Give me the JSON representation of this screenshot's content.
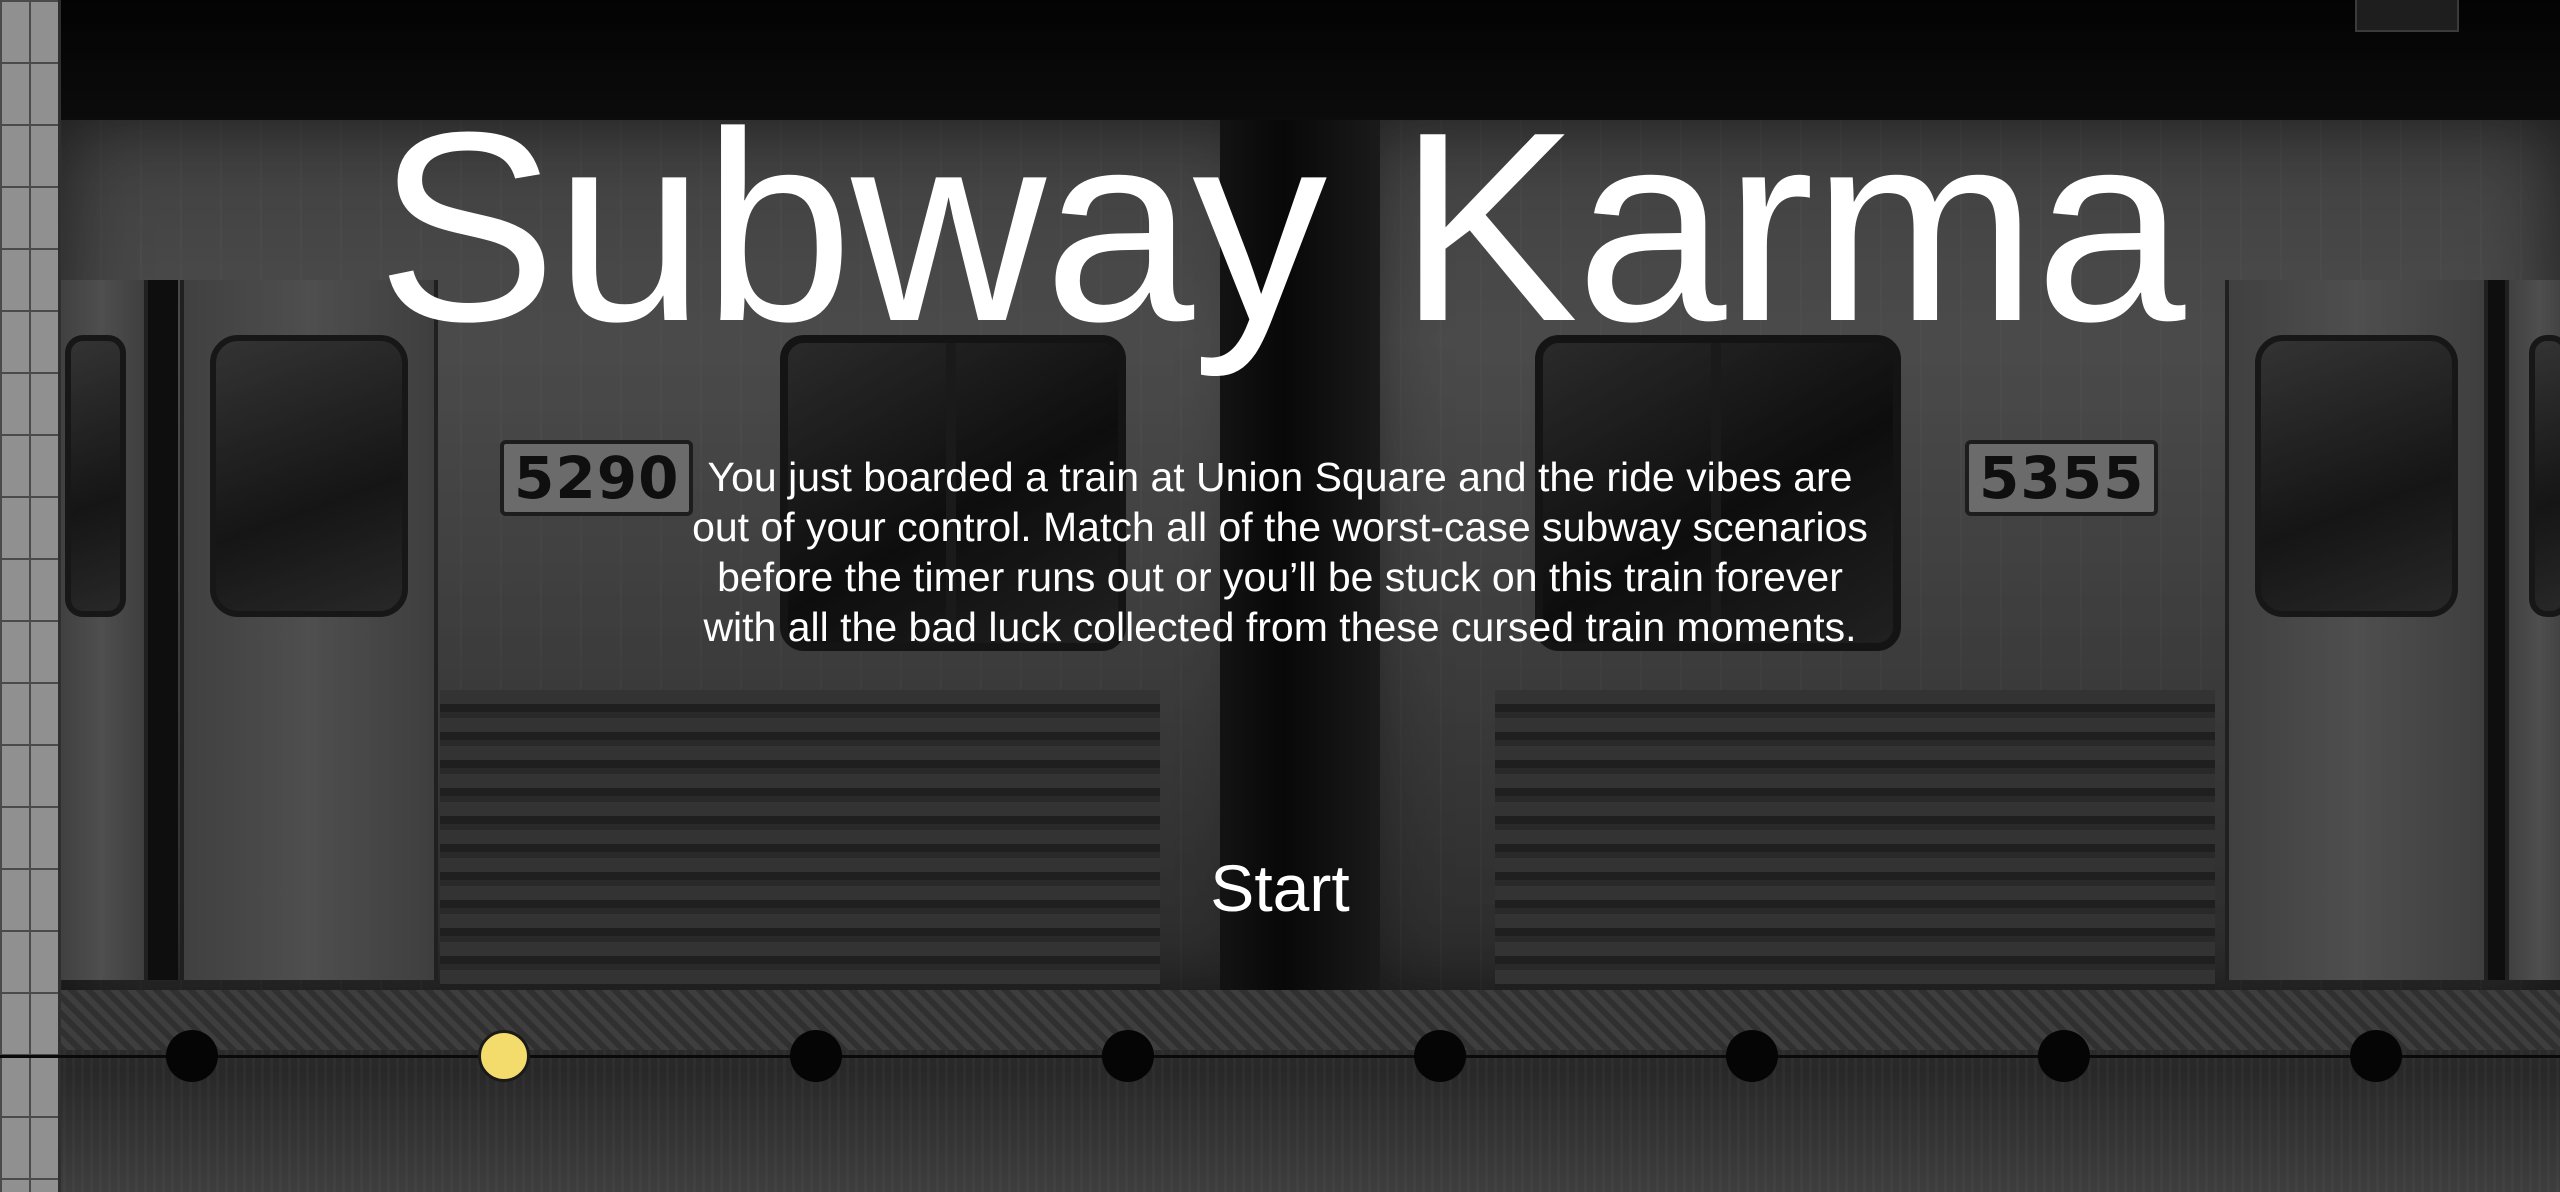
{
  "title": "Subway Karma",
  "intro": "You just boarded a train at Union Square and the ride vibes are out of your control. Match all of the worst-case subway scenarios before the timer runs out or you’ll be stuck on this train forever with all the bad luck collected from these cursed train moments.",
  "start_label": "Start",
  "train_numbers": [
    "5290",
    "5355"
  ],
  "progress": {
    "total_stops": 8,
    "active_stop": 2,
    "active_color": "#f3dc6b",
    "inactive_color": "#050505"
  }
}
